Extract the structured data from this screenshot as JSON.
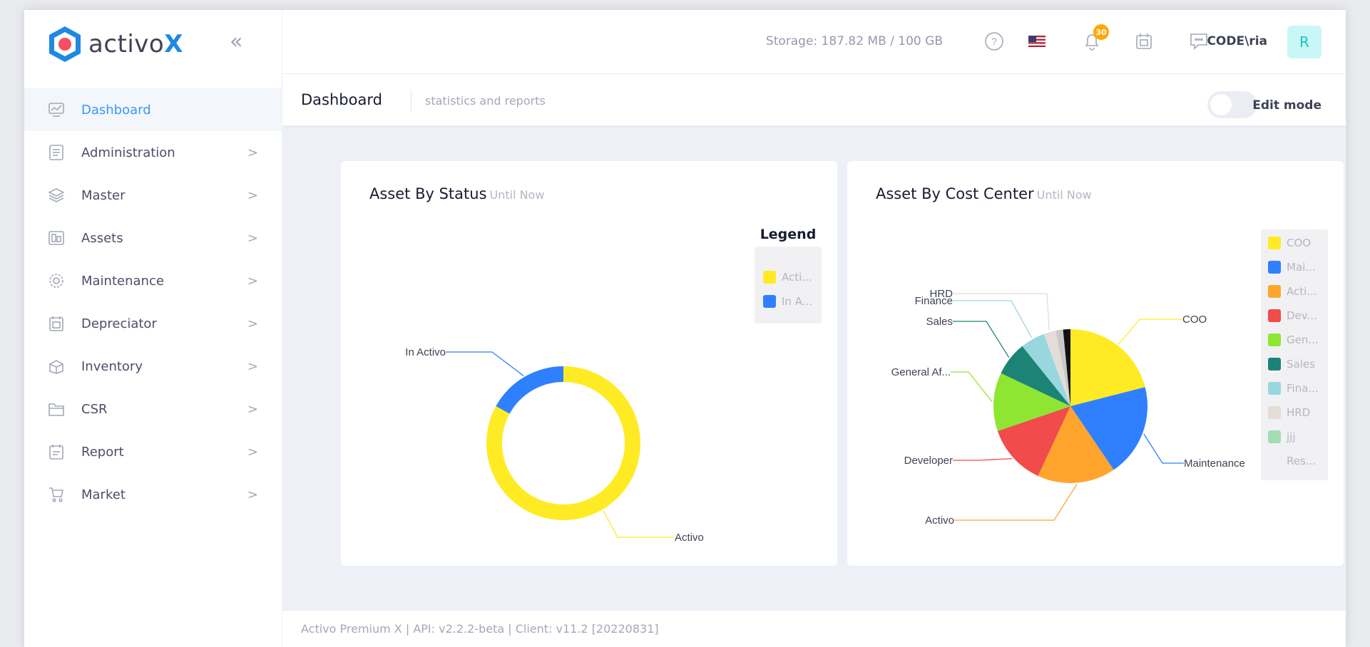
{
  "app": {
    "logo_text": "activo",
    "logo_accent": "X",
    "collapse_icon": "double-chevron-left-icon"
  },
  "sidebar": {
    "items": [
      {
        "label": "Dashboard",
        "icon": "chart-icon",
        "active": true,
        "has_arrow": false
      },
      {
        "label": "Administration",
        "icon": "admin-icon",
        "has_arrow": true
      },
      {
        "label": "Master",
        "icon": "layers-icon",
        "has_arrow": true
      },
      {
        "label": "Assets",
        "icon": "assets-icon",
        "has_arrow": true
      },
      {
        "label": "Maintenance",
        "icon": "gear-icon",
        "has_arrow": true
      },
      {
        "label": "Depreciator",
        "icon": "calculator-icon",
        "has_arrow": true
      },
      {
        "label": "Inventory",
        "icon": "box-icon",
        "has_arrow": true
      },
      {
        "label": "CSR",
        "icon": "folder-icon",
        "has_arrow": true
      },
      {
        "label": "Report",
        "icon": "report-icon",
        "has_arrow": true
      },
      {
        "label": "Market",
        "icon": "cart-icon",
        "has_arrow": true
      }
    ],
    "arrow": ">"
  },
  "topbar": {
    "storage": "Storage: 187.82 MB / 100 GB",
    "notification_count": "30",
    "username": "CODE\\ria",
    "avatar_initial": "R"
  },
  "subheader": {
    "title": "Dashboard",
    "subtitle": "statistics and reports",
    "edit_mode_label": "Edit mode"
  },
  "cards": {
    "status": {
      "title": "Asset By Status",
      "qualifier": "Until Now",
      "legend_title": "Legend",
      "legend_items": [
        "Acti...",
        "In A..."
      ]
    },
    "cost_center": {
      "title": "Asset By Cost Center",
      "qualifier": "Until Now",
      "legend_items": [
        "COO",
        "Mai...",
        "Acti...",
        "Dev...",
        "Gen...",
        "Sales",
        "Fina...",
        "HRD",
        "jjj",
        "Res..."
      ]
    }
  },
  "footer": {
    "text": "Activo Premium X | API: v2.2.2-beta | Client: v11.2 [20220831]"
  },
  "colors": {
    "accent": "#3699ff",
    "yellow": "#ffeb24",
    "blue": "#2f80ff",
    "orange": "#ffa52e",
    "red": "#f24b4b",
    "green": "#8ee633",
    "teal": "#1c8476",
    "lightblue": "#98d7de",
    "beige": "#e3dcd7",
    "mint": "#a5dcb4",
    "grey": "#c8c8c8",
    "black": "#111111"
  },
  "chart_data": [
    {
      "type": "pie",
      "title": "Asset By Status",
      "subtitle": "Until Now",
      "donut": true,
      "legend_title": "Legend",
      "legend_position": "top-right",
      "slices": [
        {
          "label": "Activo",
          "value": 83,
          "color": "#ffeb24"
        },
        {
          "label": "In Activo",
          "value": 17,
          "color": "#2f80ff"
        }
      ]
    },
    {
      "type": "pie",
      "title": "Asset By Cost Center",
      "subtitle": "Until Now",
      "legend_position": "top-right",
      "slices": [
        {
          "label": "COO",
          "value": 20.5,
          "color": "#ffeb24"
        },
        {
          "label": "Maintenance",
          "value": 19,
          "color": "#2f80ff"
        },
        {
          "label": "Activo",
          "value": 16,
          "color": "#ffa52e"
        },
        {
          "label": "Developer",
          "value": 12.5,
          "color": "#f24b4b"
        },
        {
          "label": "General Af...",
          "value": 12,
          "color": "#8ee633"
        },
        {
          "label": "Sales",
          "value": 7,
          "color": "#1c8476"
        },
        {
          "label": "Finance",
          "value": 5,
          "color": "#98d7de"
        },
        {
          "label": "HRD",
          "value": 2.5,
          "color": "#e3dcd7"
        },
        {
          "label": "jjj",
          "value": 1.5,
          "color": "#c8c8c8"
        },
        {
          "label": "Res...",
          "value": 1.5,
          "color": "#111111"
        }
      ]
    }
  ]
}
